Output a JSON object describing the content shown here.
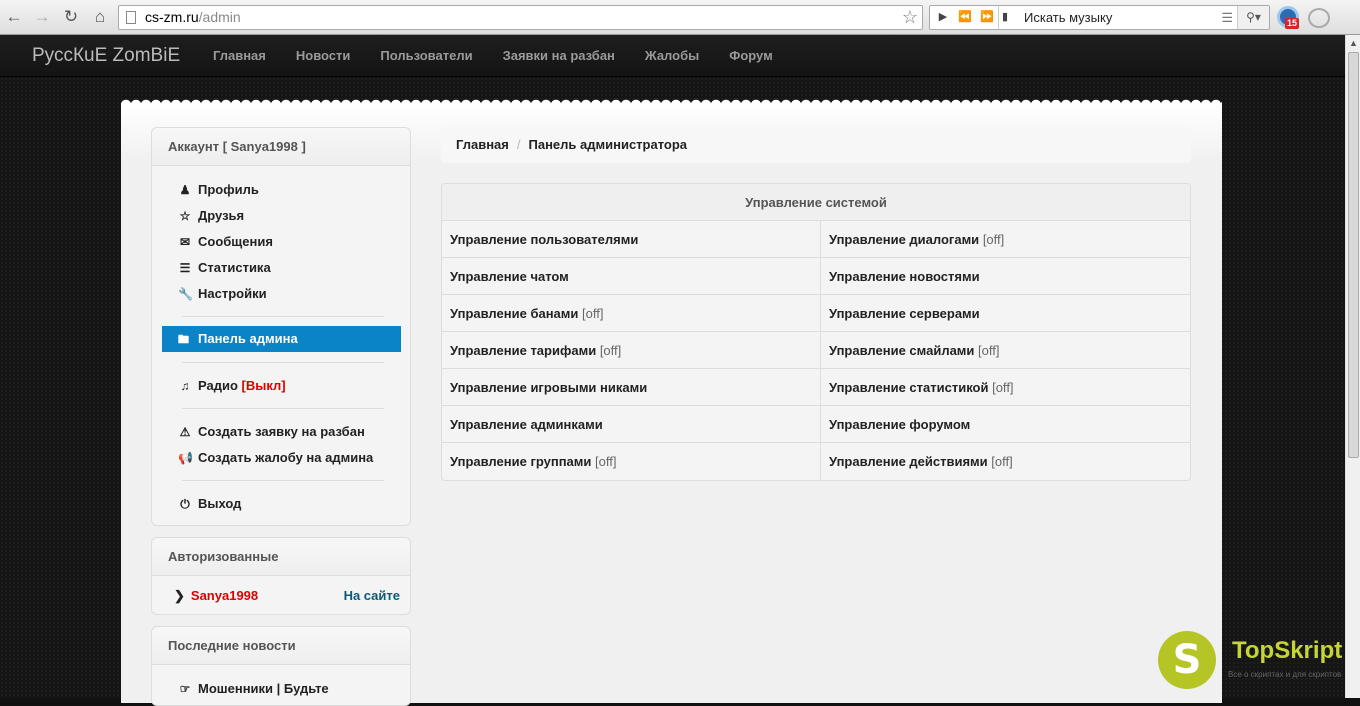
{
  "browser": {
    "url_host": "cs-zm.ru",
    "url_path": "/admin",
    "music_search_placeholder": "Искать музыку",
    "extension_badge": "15"
  },
  "site": {
    "brand": "РусcКuE ZomBiE",
    "nav": [
      "Главная",
      "Новости",
      "Пользователи",
      "Заявки на разбан",
      "Жалобы",
      "Форум"
    ]
  },
  "account": {
    "title": "Аккаунт [ Sanya1998 ]",
    "items": [
      {
        "label": "Профиль",
        "icon": "user-icon"
      },
      {
        "label": "Друзья",
        "icon": "star-icon"
      },
      {
        "label": "Сообщения",
        "icon": "envelope-icon"
      },
      {
        "label": "Статистика",
        "icon": "list-icon"
      },
      {
        "label": "Настройки",
        "icon": "wrench-icon"
      }
    ],
    "admin_panel": "Панель админа",
    "radio_label": "Радио",
    "radio_status": "[Выкл]",
    "create_unban": "Создать заявку на разбан",
    "create_complaint": "Создать жалобу на админа",
    "logout": "Выход"
  },
  "authorized": {
    "title": "Авторизованные",
    "user": "Sanya1998",
    "status": "На сайте"
  },
  "news": {
    "title": "Последние новости",
    "first_item": "Мошенники | Будьте"
  },
  "breadcrumb": {
    "home": "Главная",
    "current": "Панель администратора"
  },
  "system": {
    "title": "Управление системой",
    "off_label": "[off]",
    "rows": [
      [
        {
          "label": "Управление пользователями",
          "off": false
        },
        {
          "label": "Управление диалогами",
          "off": true
        }
      ],
      [
        {
          "label": "Управление чатом",
          "off": false
        },
        {
          "label": "Управление новостями",
          "off": false
        }
      ],
      [
        {
          "label": "Управление банами",
          "off": true
        },
        {
          "label": "Управление серверами",
          "off": false
        }
      ],
      [
        {
          "label": "Управление тарифами",
          "off": true
        },
        {
          "label": "Управление смайлами",
          "off": true
        }
      ],
      [
        {
          "label": "Управление игровыми никами",
          "off": false
        },
        {
          "label": "Управление статистикой",
          "off": true
        }
      ],
      [
        {
          "label": "Управление админками",
          "off": false
        },
        {
          "label": "Управление форумом",
          "off": false
        }
      ],
      [
        {
          "label": "Управление группами",
          "off": true
        },
        {
          "label": "Управление действиями",
          "off": true
        }
      ]
    ]
  },
  "watermark": {
    "logo_letter": "S",
    "name": "TopSkript",
    "tagline": "Все о скриптах и для скриптов"
  }
}
